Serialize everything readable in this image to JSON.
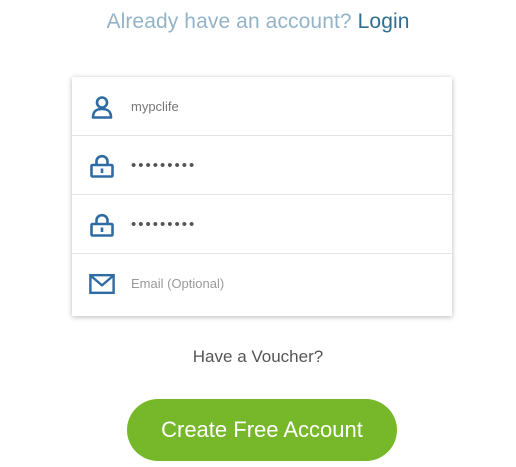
{
  "header": {
    "prompt_text": "Already have an account?",
    "login_link": "Login"
  },
  "form": {
    "username_value": "mypclife",
    "password_value": "•••••••••",
    "confirm_password_value": "•••••••••",
    "email_placeholder": "Email (Optional)"
  },
  "icons": {
    "username": "user-icon",
    "password": "lock-icon",
    "confirm_password": "lock-icon",
    "email": "envelope-icon"
  },
  "voucher_link": "Have a Voucher?",
  "submit_label": "Create Free Account",
  "colors": {
    "prompt": "#93b3c7",
    "link": "#2f6e92",
    "icon": "#2f6ca3",
    "button": "#76b82a"
  }
}
